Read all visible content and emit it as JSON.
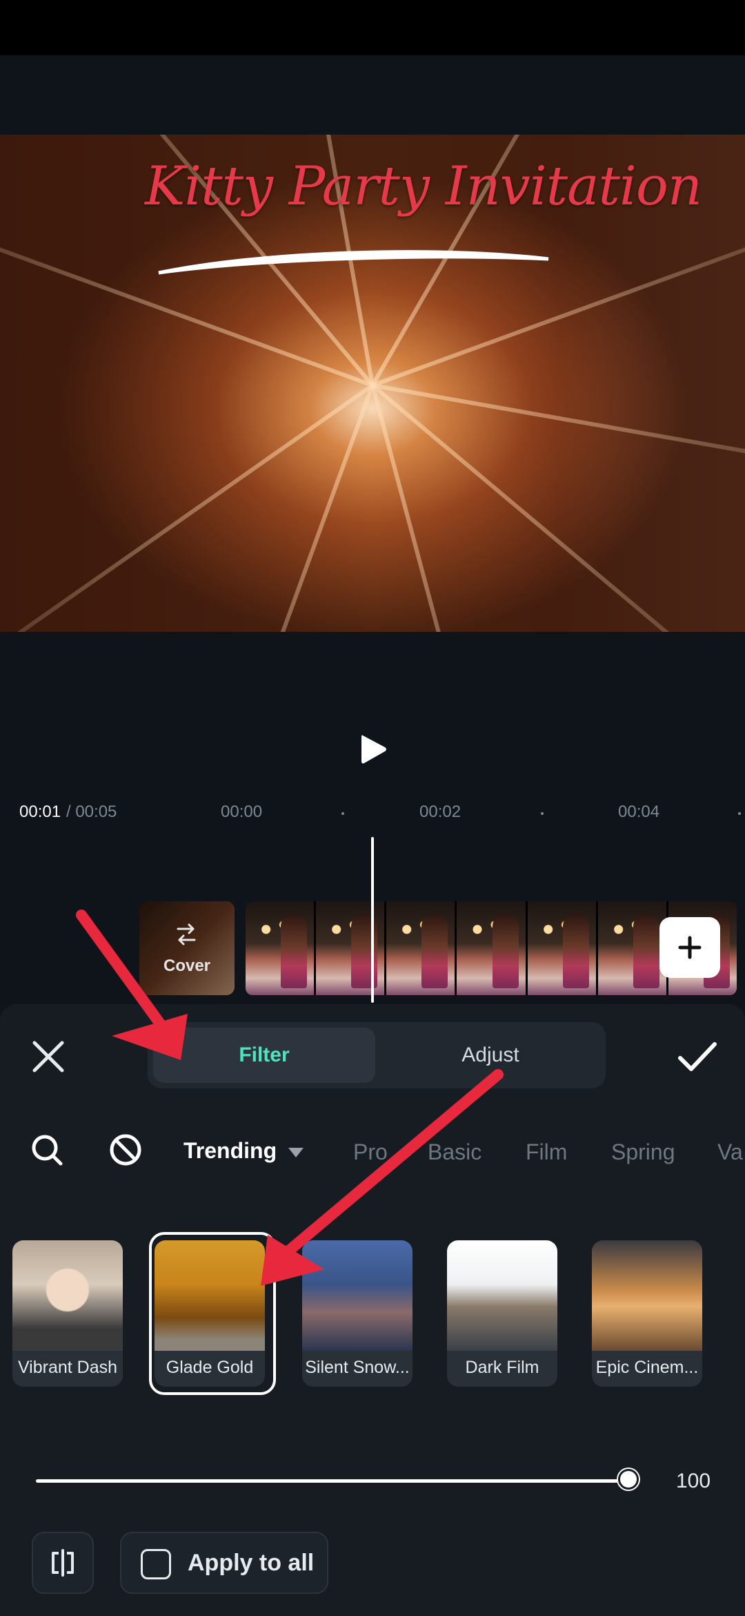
{
  "video": {
    "title_text": "Kitty Party Invitation"
  },
  "player": {
    "play_icon": "play-icon"
  },
  "timeline": {
    "current_time": "00:01",
    "total_time": "/ 00:05",
    "ticks": [
      "00:00",
      "00:02",
      "00:04"
    ],
    "cover_label": "Cover"
  },
  "panel": {
    "tabs": [
      {
        "label": "Filter",
        "active": true
      },
      {
        "label": "Adjust",
        "active": false
      }
    ],
    "categories": {
      "active": "Trending",
      "items": [
        "Pro",
        "Basic",
        "Film",
        "Spring",
        "Va"
      ]
    },
    "filters": [
      {
        "label": "Vibrant Dash",
        "selected": false
      },
      {
        "label": "Glade Gold",
        "selected": true
      },
      {
        "label": "Silent Snow...",
        "selected": false
      },
      {
        "label": "Dark Film",
        "selected": false
      },
      {
        "label": "Epic Cinem...",
        "selected": false
      }
    ],
    "intensity": {
      "value": "100",
      "level": 1.0
    },
    "apply_all_label": "Apply to all"
  },
  "colors": {
    "accent": "#4fe3c0",
    "annotation": "#e8283c",
    "panel_bg": "#171c23"
  }
}
